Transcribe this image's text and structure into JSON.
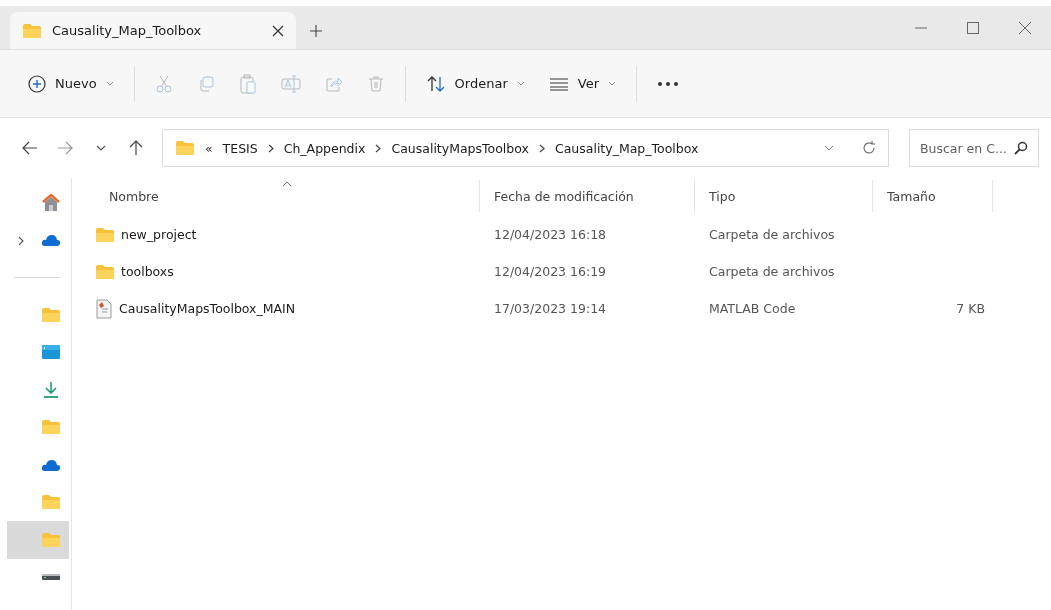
{
  "window": {
    "tab": {
      "title": "Causality_Map_Toolbox",
      "selected": true
    }
  },
  "toolbar": {
    "items": [
      {
        "kind": "new",
        "label": "Nuevo",
        "disabled": false
      },
      {
        "kind": "cut",
        "disabled": true
      },
      {
        "kind": "copy",
        "disabled": true
      },
      {
        "kind": "paste",
        "disabled": true
      },
      {
        "kind": "rename",
        "disabled": true
      },
      {
        "kind": "share",
        "disabled": true
      },
      {
        "kind": "delete",
        "disabled": true
      },
      {
        "kind": "sort",
        "label": "Ordenar",
        "disabled": false
      },
      {
        "kind": "view",
        "label": "Ver",
        "disabled": false
      },
      {
        "kind": "more",
        "disabled": false
      }
    ]
  },
  "address": {
    "overflow": "«",
    "crumbs": [
      "TESIS",
      "Ch_Appendix",
      "CausalityMapsToolbox",
      "Causality_Map_Toolbox"
    ],
    "search_placeholder": "Buscar en C..."
  },
  "sidebar": {
    "pinned": [
      {
        "kind": "home",
        "selected": false,
        "expandable": false
      },
      {
        "kind": "cloud",
        "selected": false,
        "expandable": true
      }
    ],
    "items": [
      {
        "kind": "folder",
        "selected": false,
        "expandable": false
      },
      {
        "kind": "desktop",
        "selected": false,
        "expandable": false
      },
      {
        "kind": "download",
        "selected": false,
        "expandable": false
      },
      {
        "kind": "folder",
        "selected": false,
        "expandable": false
      },
      {
        "kind": "cloud",
        "selected": false,
        "expandable": false
      },
      {
        "kind": "folder",
        "selected": false,
        "expandable": false
      },
      {
        "kind": "folder",
        "selected": true,
        "expandable": false
      },
      {
        "kind": "drive",
        "selected": false,
        "expandable": false
      }
    ]
  },
  "table": {
    "columns": [
      {
        "label": "Nombre",
        "sorted": true
      },
      {
        "label": "Fecha de modificación",
        "sorted": false
      },
      {
        "label": "Tipo",
        "sorted": false
      },
      {
        "label": "Tamaño",
        "sorted": false
      }
    ],
    "rows": [
      {
        "kind": "folder",
        "name": "new_project",
        "date": "12/04/2023 16:18",
        "type": "Carpeta de archivos",
        "selected": false
      },
      {
        "kind": "folder",
        "name": "toolboxs",
        "date": "12/04/2023 16:19",
        "type": "Carpeta de archivos",
        "selected": false
      },
      {
        "kind": "matlab",
        "name": "CausalityMapsToolbox_MAIN",
        "date": "17/03/2023 19:14",
        "type": "MATLAB Code",
        "size": "7 KB",
        "selected": false
      }
    ]
  }
}
